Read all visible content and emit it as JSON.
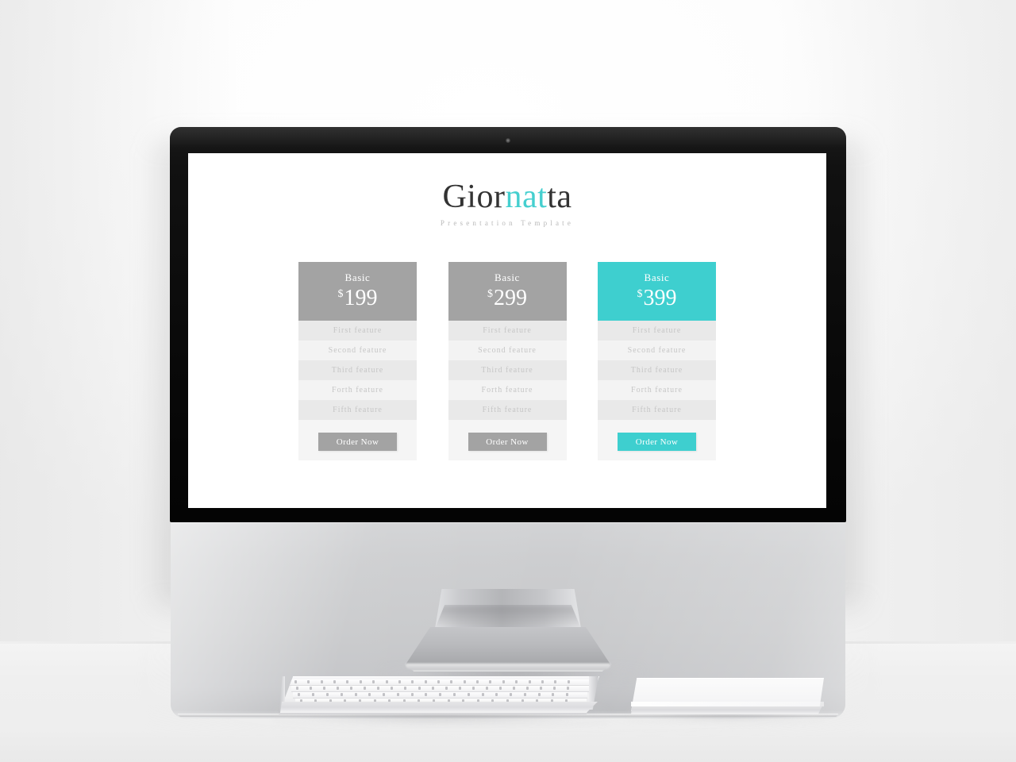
{
  "slide": {
    "brand": {
      "title_part1": "Gior",
      "title_accent": "nat",
      "title_part2": "ta",
      "subtitle": "Presentation  Template"
    },
    "accent_color": "#3ecfcf",
    "muted_color": "#a3a3a3",
    "pricing_cards": [
      {
        "plan": "Basic",
        "currency": "$",
        "price": "199",
        "features": [
          "First  feature",
          "Second  feature",
          "Third  feature",
          "Forth  feature",
          "Fifth  feature"
        ],
        "cta_label": "Order Now",
        "highlighted": false
      },
      {
        "plan": "Basic",
        "currency": "$",
        "price": "299",
        "features": [
          "First  feature",
          "Second  feature",
          "Third  feature",
          "Forth  feature",
          "Fifth  feature"
        ],
        "cta_label": "Order Now",
        "highlighted": false
      },
      {
        "plan": "Basic",
        "currency": "$",
        "price": "399",
        "features": [
          "First  feature",
          "Second  feature",
          "Third  feature",
          "Forth  feature",
          "Fifth  feature"
        ],
        "cta_label": "Order Now",
        "highlighted": true
      }
    ]
  },
  "device": {
    "type": "desktop-monitor",
    "peripherals": [
      "keyboard",
      "trackpad"
    ]
  }
}
